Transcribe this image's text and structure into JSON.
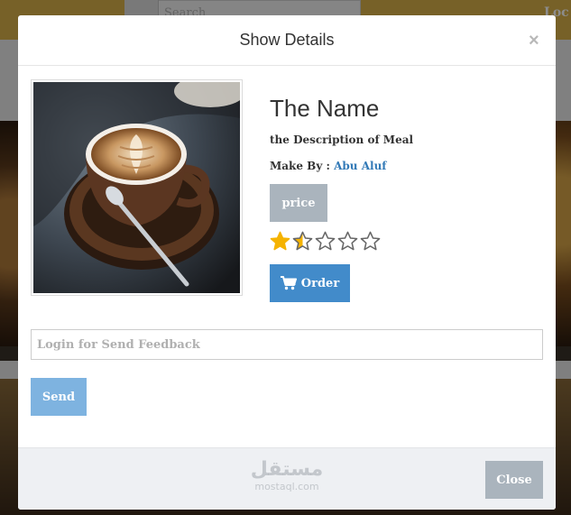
{
  "background": {
    "search_placeholder": "Search",
    "login_label": "Loc"
  },
  "modal": {
    "title": "Show Details",
    "close_glyph": "×"
  },
  "meal": {
    "name": "The Name",
    "description": "the Description of Meal",
    "make_by_label": "Make By :",
    "chef_name": "Abu Aluf",
    "price_label": "price",
    "rating": 1.5,
    "rating_max": 5,
    "star_colors": {
      "filled": "#f5b301",
      "empty_stroke": "#666666"
    },
    "order_label": "Order",
    "order_icon": "shopping-cart-icon"
  },
  "feedback": {
    "placeholder": "Login for Send Feedback",
    "value": "",
    "send_label": "Send"
  },
  "footer": {
    "watermark_arabic": "مستقل",
    "watermark_latin": "mostaql.com",
    "close_label": "Close"
  },
  "colors": {
    "primary": "#428bca",
    "send": "#7eb3e0",
    "muted_button": "#aab4bd",
    "link": "#337ab7",
    "header_bar": "#d9b14a"
  }
}
